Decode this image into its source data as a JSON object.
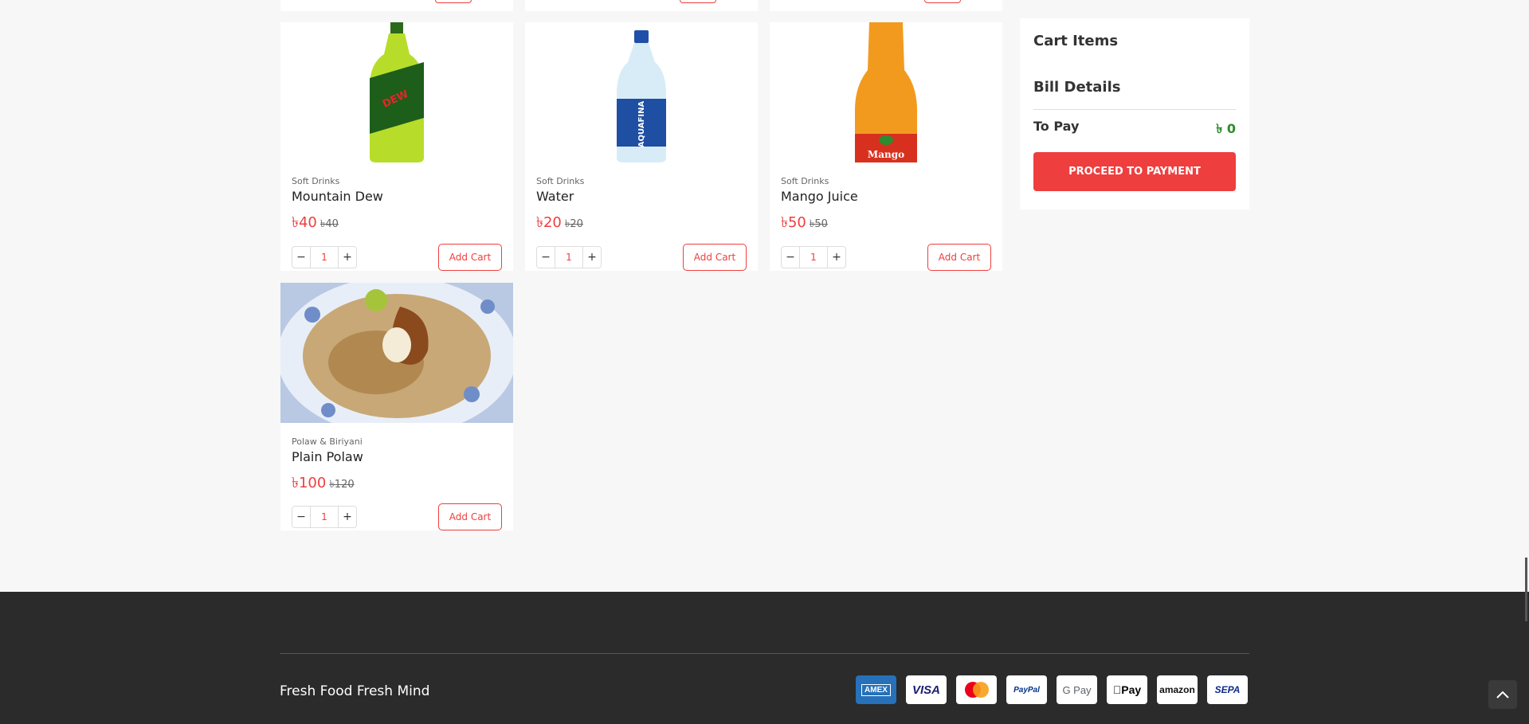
{
  "currency": "৳",
  "products": [
    {
      "category": "Soft Drinks",
      "name": "Mountain Dew",
      "price": "৳40",
      "old_price": "৳40",
      "qty": "1",
      "add_label": "Add Cart",
      "image_icon": "mountain-dew-bottle"
    },
    {
      "category": "Soft Drinks",
      "name": "Water",
      "price": "৳20",
      "old_price": "৳20",
      "qty": "1",
      "add_label": "Add Cart",
      "image_icon": "water-bottle"
    },
    {
      "category": "Soft Drinks",
      "name": "Mango Juice",
      "price": "৳50",
      "old_price": "৳50",
      "qty": "1",
      "add_label": "Add Cart",
      "image_icon": "mango-juice-bottle"
    },
    {
      "category": "Polaw & Biriyani",
      "name": "Plain Polaw",
      "price": "৳100",
      "old_price": "৳120",
      "qty": "1",
      "add_label": "Add Cart",
      "image_icon": "polaw-plate"
    }
  ],
  "qty_controls": {
    "minus": "−",
    "plus": "+"
  },
  "cart": {
    "title": "Cart Items",
    "bill_title": "Bill Details",
    "to_pay_label": "To Pay",
    "to_pay_value": "৳ 0",
    "pay_button": "PROCEED TO PAYMENT"
  },
  "footer": {
    "tagline": "Fresh Food Fresh Mind",
    "payment_methods": [
      "AMEX",
      "VISA",
      "Mastercard",
      "PayPal",
      "G Pay",
      "Pay",
      "amazon",
      "SEPA"
    ]
  },
  "colors": {
    "accent": "#ef3e3e",
    "price_green": "#2e8b2e",
    "footer_bg": "#2b2b2b"
  }
}
